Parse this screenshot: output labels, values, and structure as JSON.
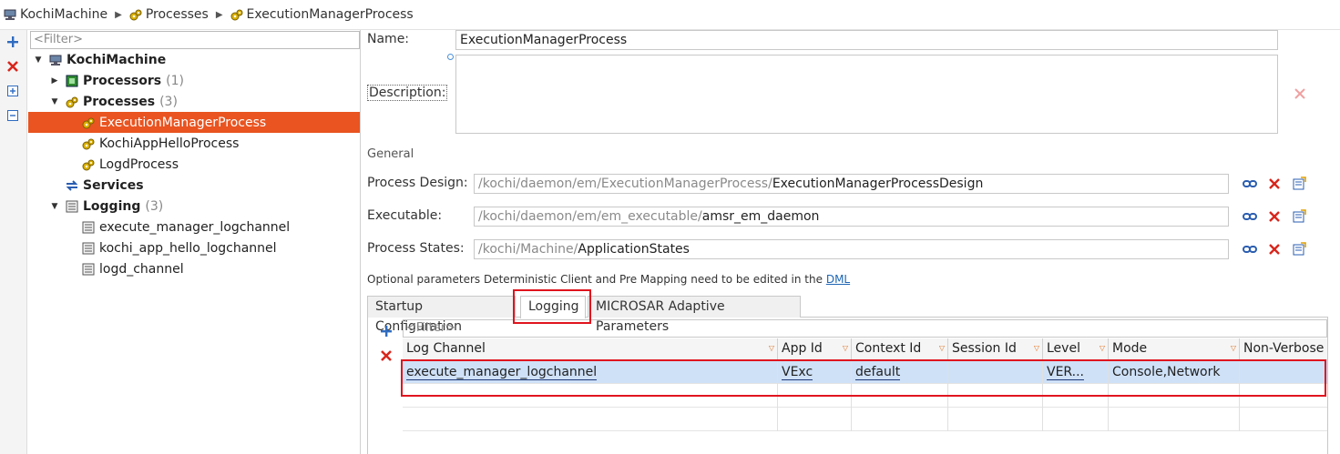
{
  "breadcrumb": [
    "KochiMachine",
    "Processes",
    "ExecutionManagerProcess"
  ],
  "tree": {
    "filter_placeholder": "<Filter>",
    "nodes": [
      {
        "label": "KochiMachine",
        "count": ""
      },
      {
        "label": "Processors",
        "count": "(1)"
      },
      {
        "label": "Processes",
        "count": "(3)"
      },
      {
        "label": "ExecutionManagerProcess",
        "count": ""
      },
      {
        "label": "KochiAppHelloProcess",
        "count": ""
      },
      {
        "label": "LogdProcess",
        "count": ""
      },
      {
        "label": "Services",
        "count": ""
      },
      {
        "label": "Logging",
        "count": "(3)"
      },
      {
        "label": "execute_manager_logchannel",
        "count": ""
      },
      {
        "label": "kochi_app_hello_logchannel",
        "count": ""
      },
      {
        "label": "logd_channel",
        "count": ""
      }
    ]
  },
  "editor": {
    "name_label": "Name:",
    "name_value": "ExecutionManagerProcess",
    "description_label": "Description:",
    "description_value": "",
    "section_general": "General",
    "process_design_label": "Process Design:",
    "process_design_prefix": "/kochi/daemon/em/ExecutionManagerProcess/",
    "process_design_value": "ExecutionManagerProcessDesign",
    "executable_label": "Executable:",
    "executable_prefix": "/kochi/daemon/em/em_executable/",
    "executable_value": "amsr_em_daemon",
    "process_states_label": "Process States:",
    "process_states_prefix": "/kochi/Machine/",
    "process_states_value": "ApplicationStates",
    "optional_note": "Optional parameters Deterministic Client and Pre Mapping need to be edited in the",
    "optional_link": "DML"
  },
  "tabs": [
    "Startup Configuration",
    "Logging",
    "MICROSAR Adaptive Parameters"
  ],
  "active_tab": "Logging",
  "logging_table": {
    "filter_placeholder": "<Filter>",
    "columns": [
      "Log Channel",
      "App Id",
      "Context Id",
      "Session Id",
      "Level",
      "Mode",
      "Non-Verbose"
    ],
    "rows": [
      {
        "log_channel": "execute_manager_logchannel",
        "app_id": "VExc",
        "context_id": "default",
        "session_id": "",
        "level": "VER...",
        "mode": "Console,Network",
        "non_verbose": ""
      }
    ]
  },
  "colors": {
    "selection": "#e95420",
    "highlight_box": "#e0141e",
    "row_selected": "#cfe1f7"
  }
}
